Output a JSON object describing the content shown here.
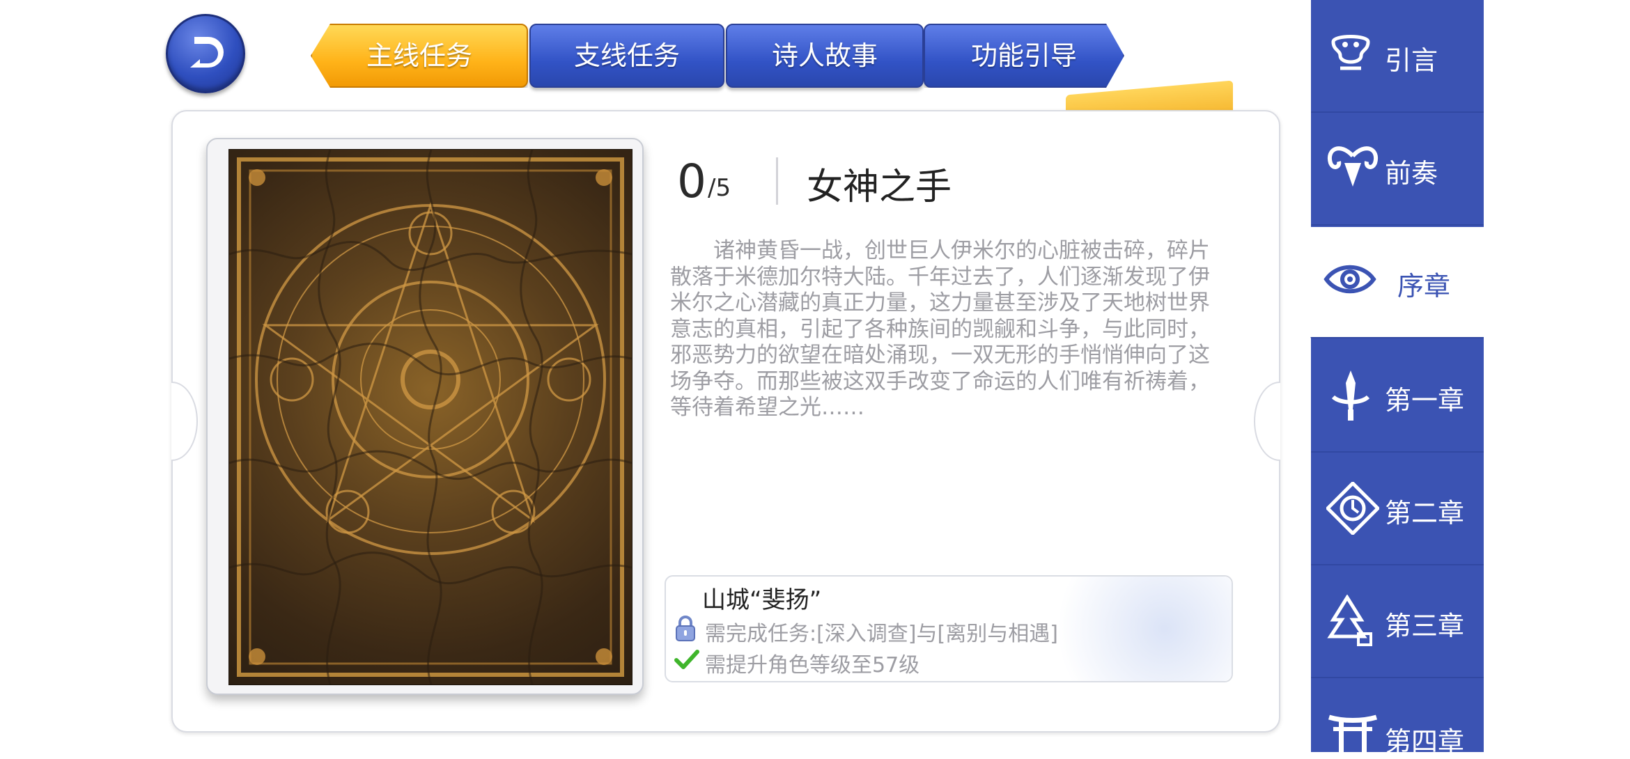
{
  "top_tabs": [
    {
      "label": "主线任务"
    },
    {
      "label": "支线任务"
    },
    {
      "label": "诗人故事"
    },
    {
      "label": "功能引导"
    }
  ],
  "card": {
    "progress_current": "0",
    "progress_total": "/5",
    "title": "女神之手",
    "description": "诸神黄昏一战，创世巨人伊米尔的心脏被击碎，碎片散落于米德加尔特大陆。千年过去了，人们逐渐发现了伊米尔之心潜藏的真正力量，这力量甚至涉及了天地树世界意志的真相，引起了各种族间的觊觎和斗争，与此同时，邪恶势力的欲望在暗处涌现，一双无形的手悄悄伸向了这场争夺。而那些被这双手改变了命运的人们唯有祈祷着，等待着希望之光……"
  },
  "unlock": {
    "location": "山城“斐扬”",
    "requirement_1": "需完成任务:[深入调查]与[离别与相遇]",
    "requirement_2": "需提升角色等级至57级"
  },
  "chapters": [
    {
      "label": "引言",
      "icon": "mask-icon"
    },
    {
      "label": "前奏",
      "icon": "ram-icon"
    },
    {
      "label": "序章",
      "icon": "eye-icon"
    },
    {
      "label": "第一章",
      "icon": "sword-icon"
    },
    {
      "label": "第二章",
      "icon": "compass-icon"
    },
    {
      "label": "第三章",
      "icon": "tree-icon"
    },
    {
      "label": "第四章",
      "icon": "torii-icon"
    }
  ],
  "colors": {
    "sidebar_blue": "#3b53b3",
    "tab_active_yellow": "#ffb319",
    "tab_blue": "#3253c6"
  }
}
